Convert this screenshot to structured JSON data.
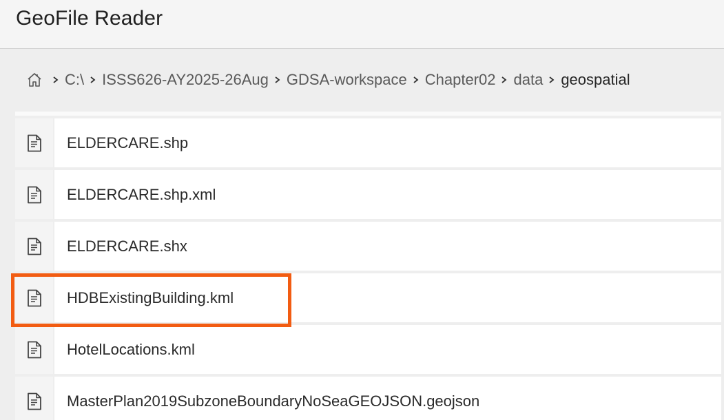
{
  "app": {
    "title": "GeoFile Reader"
  },
  "breadcrumb": {
    "home_icon": "home-icon",
    "items": [
      "C:\\",
      "ISSS626-AY2025-26Aug",
      "GDSA-workspace",
      "Chapter02",
      "data",
      "geospatial"
    ]
  },
  "files": {
    "icon": "file-document-icon",
    "items": [
      {
        "name": "ELDERCARE.shp"
      },
      {
        "name": "ELDERCARE.shp.xml"
      },
      {
        "name": "ELDERCARE.shx"
      },
      {
        "name": "HDBExistingBuilding.kml",
        "highlighted": true
      },
      {
        "name": "HotelLocations.kml"
      },
      {
        "name": "MasterPlan2019SubzoneBoundaryNoSeaGEOJSON.geojson"
      }
    ]
  },
  "colors": {
    "highlight": "#f25c12",
    "background": "#eeeeee",
    "row": "#ffffff",
    "icon_cell": "#f4f4f4"
  }
}
